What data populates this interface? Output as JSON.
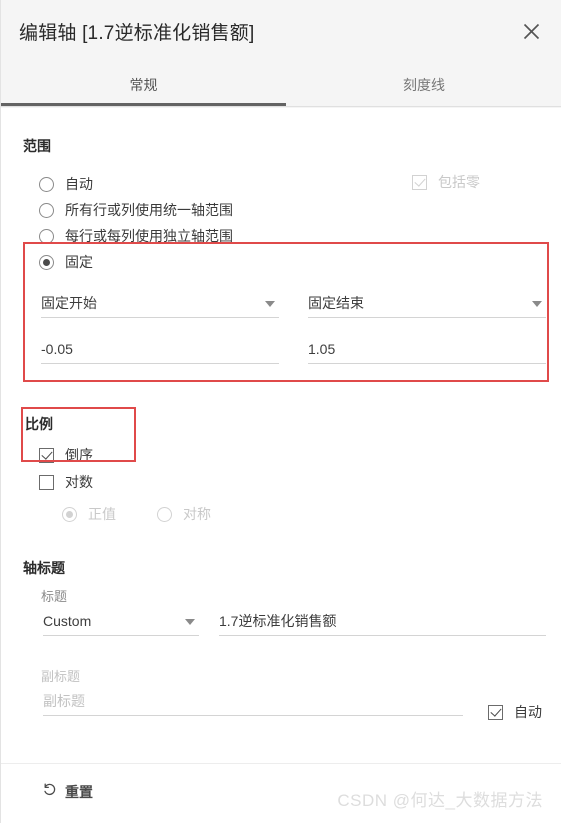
{
  "dialog": {
    "title": "编辑轴 [1.7逆标准化销售额]",
    "close_icon": "close-icon"
  },
  "tabs": [
    {
      "label": "常规",
      "active": true
    },
    {
      "label": "刻度线",
      "active": false
    }
  ],
  "range_section": {
    "title": "范围",
    "options": [
      {
        "label": "自动",
        "selected": false
      },
      {
        "label": "所有行或列使用统一轴范围",
        "selected": false
      },
      {
        "label": "每行或每列使用独立轴范围",
        "selected": false
      },
      {
        "label": "固定",
        "selected": true
      }
    ],
    "include_zero": {
      "label": "包括零",
      "checked": true,
      "disabled": true
    },
    "fixed_start": {
      "label": "固定开始",
      "value": "-0.05"
    },
    "fixed_end": {
      "label": "固定结束",
      "value": "1.05"
    }
  },
  "scale_section": {
    "title": "比例",
    "reversed": {
      "label": "倒序",
      "checked": true
    },
    "logarithmic": {
      "label": "对数",
      "checked": false
    },
    "log_modes": [
      {
        "label": "正值",
        "selected": true,
        "disabled": true
      },
      {
        "label": "对称",
        "selected": false,
        "disabled": true
      }
    ]
  },
  "axis_title_section": {
    "title": "轴标题",
    "title_label": "标题",
    "title_mode": "Custom",
    "title_value": "1.7逆标准化销售额",
    "subtitle_label": "副标题",
    "subtitle_placeholder": "副标题",
    "subtitle_auto": {
      "label": "自动",
      "checked": true
    }
  },
  "footer": {
    "reset_label": "重置",
    "reset_icon": "undo-icon",
    "watermark": "CSDN @何达_大数据方法"
  },
  "colors": {
    "accent_red": "#e04a4a",
    "header_bg": "#f5f5f5",
    "tab_underline": "#636363"
  }
}
